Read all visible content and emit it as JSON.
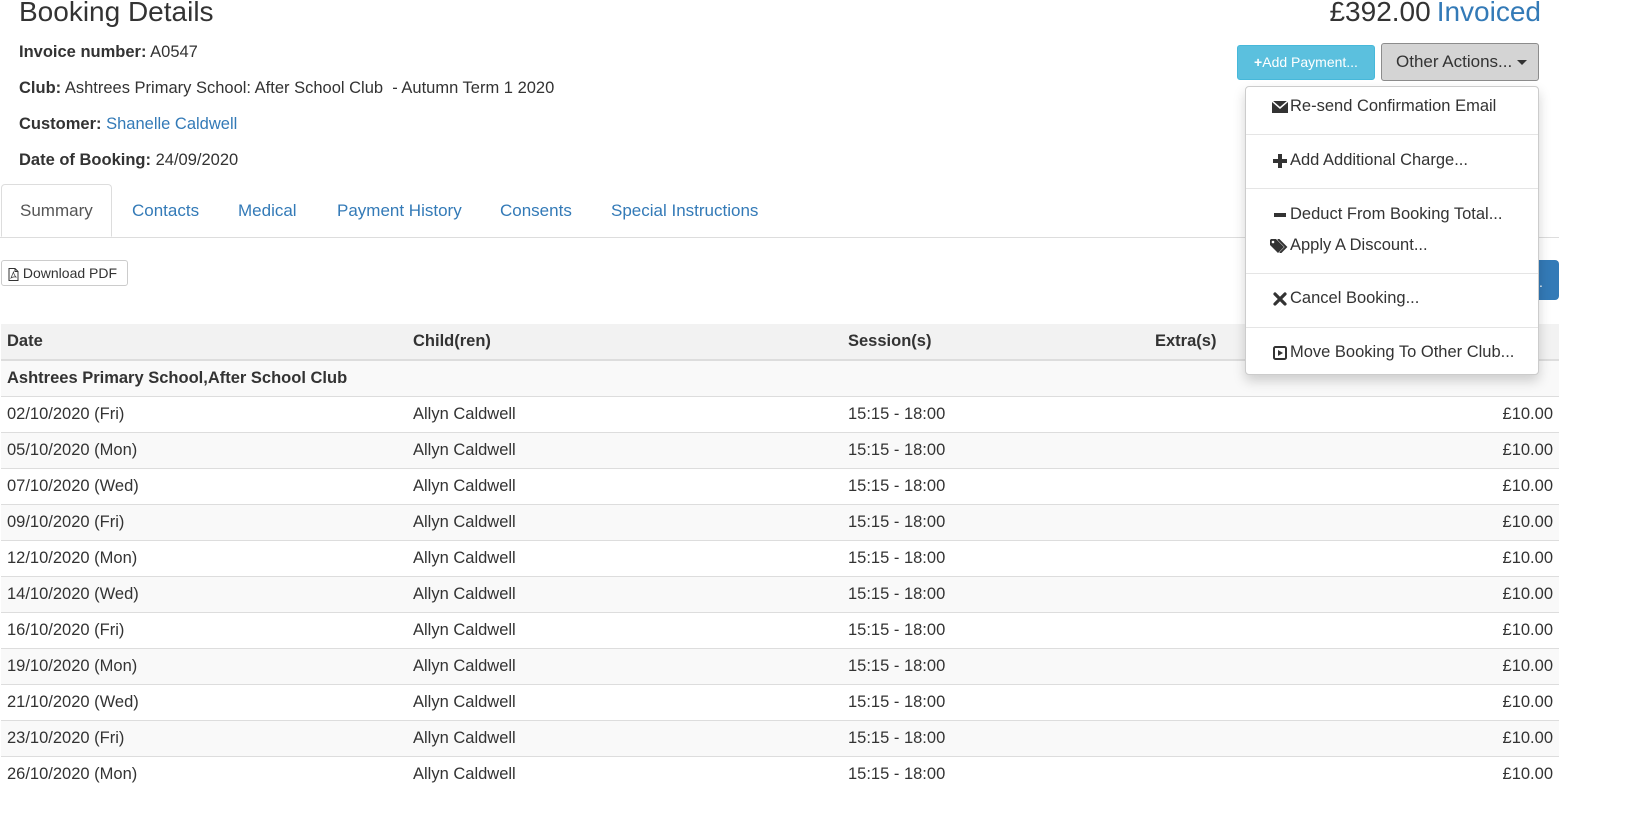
{
  "header": {
    "title": "Booking Details",
    "amount": "£392.00",
    "status": "Invoiced"
  },
  "details": {
    "invoice_label": "Invoice number:",
    "invoice_value": "A0547",
    "club_label": "Club:",
    "club_value": "Ashtrees Primary School: After School Club  - Autumn Term 1 2020",
    "customer_label": "Customer:",
    "customer_value": "Shanelle Caldwell",
    "date_label": "Date of Booking:",
    "date_value": "24/09/2020"
  },
  "actions": {
    "add_payment": "Add Payment...",
    "other_actions": "Other Actions..."
  },
  "tabs": [
    "Summary",
    "Contacts",
    "Medical",
    "Payment History",
    "Consents",
    "Special Instructions"
  ],
  "download_pdf": "Download PDF",
  "table": {
    "headers": [
      "Date",
      "Child(ren)",
      "Session(s)",
      "Extra(s)"
    ],
    "group": "Ashtrees Primary School,After School Club",
    "rows": [
      {
        "date": "02/10/2020 (Fri)",
        "child": "Allyn Caldwell",
        "session": "15:15 - 18:00",
        "price": "£10.00"
      },
      {
        "date": "05/10/2020 (Mon)",
        "child": "Allyn Caldwell",
        "session": "15:15 - 18:00",
        "price": "£10.00"
      },
      {
        "date": "07/10/2020 (Wed)",
        "child": "Allyn Caldwell",
        "session": "15:15 - 18:00",
        "price": "£10.00"
      },
      {
        "date": "09/10/2020 (Fri)",
        "child": "Allyn Caldwell",
        "session": "15:15 - 18:00",
        "price": "£10.00"
      },
      {
        "date": "12/10/2020 (Mon)",
        "child": "Allyn Caldwell",
        "session": "15:15 - 18:00",
        "price": "£10.00"
      },
      {
        "date": "14/10/2020 (Wed)",
        "child": "Allyn Caldwell",
        "session": "15:15 - 18:00",
        "price": "£10.00"
      },
      {
        "date": "16/10/2020 (Fri)",
        "child": "Allyn Caldwell",
        "session": "15:15 - 18:00",
        "price": "£10.00"
      },
      {
        "date": "19/10/2020 (Mon)",
        "child": "Allyn Caldwell",
        "session": "15:15 - 18:00",
        "price": "£10.00"
      },
      {
        "date": "21/10/2020 (Wed)",
        "child": "Allyn Caldwell",
        "session": "15:15 - 18:00",
        "price": "£10.00"
      },
      {
        "date": "23/10/2020 (Fri)",
        "child": "Allyn Caldwell",
        "session": "15:15 - 18:00",
        "price": "£10.00"
      },
      {
        "date": "26/10/2020 (Mon)",
        "child": "Allyn Caldwell",
        "session": "15:15 - 18:00",
        "price": "£10.00"
      }
    ]
  },
  "dropdown": {
    "items": [
      {
        "label": "Re-send Confirmation Email",
        "icon": "envelope-icon"
      },
      {
        "label": "Add Additional Charge...",
        "icon": "plus-icon"
      },
      {
        "label": "Deduct From Booking Total...",
        "icon": "minus-icon"
      },
      {
        "label": "Apply A Discount...",
        "icon": "tags-icon"
      },
      {
        "label": "Cancel Booking...",
        "icon": "x-icon"
      },
      {
        "label": "Move Booking To Other Club...",
        "icon": "play-square-icon"
      }
    ]
  },
  "colors": {
    "link": "#337ab7",
    "info_button": "#5bc0de",
    "default_button_active": "#d4d4d4"
  }
}
